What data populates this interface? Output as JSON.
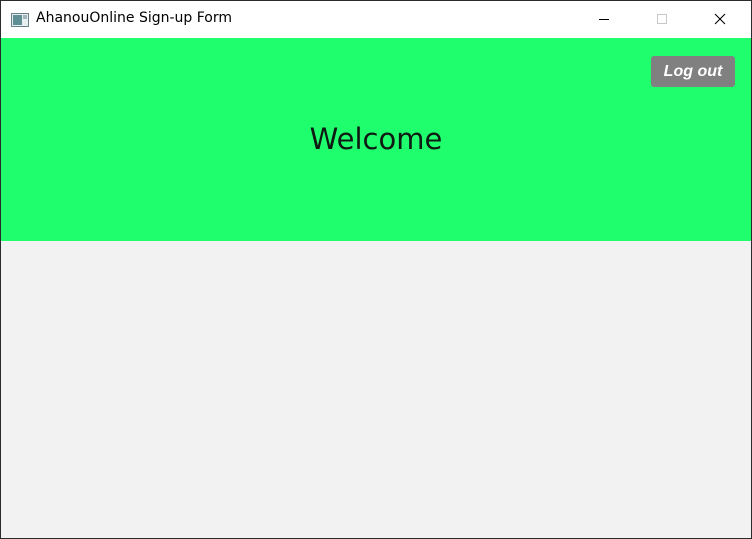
{
  "window": {
    "title": "AhanouOnline Sign-up Form",
    "icon": "app-window-icon",
    "controls": {
      "minimize_icon": "minimize-icon",
      "maximize_icon": "maximize-icon",
      "close_icon": "close-icon"
    }
  },
  "header": {
    "welcome_text": "Welcome",
    "logout_label": "Log out",
    "background_color": "#1fff6e",
    "logout_button_color": "#808080"
  },
  "content": {
    "background_color": "#f2f2f2"
  }
}
